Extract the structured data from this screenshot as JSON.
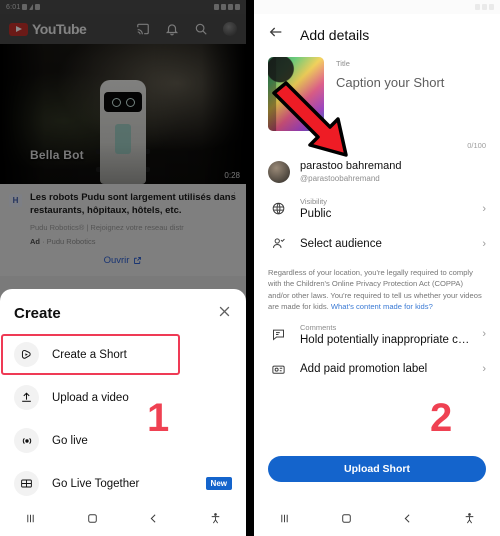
{
  "left_phone": {
    "status_bar": {
      "time": "6:01"
    },
    "youtube_header": {
      "brand": "YouTube",
      "icons": [
        "cast-icon",
        "bell-icon",
        "search-icon",
        "account-avatar"
      ]
    },
    "video": {
      "caption": "Bella Bot",
      "duration": "0:28"
    },
    "ad": {
      "badge": "H",
      "title": "Les robots Pudu sont largement utilisés dans restaurants, hôpitaux, hôtels, etc.",
      "subtitle": "Pudu Robotics® | Rejoignez votre reseau distr",
      "meta_label": "Ad",
      "meta_advertiser": "· Pudu Robotics",
      "cta": "Ouvrir",
      "menu_icon": "more-vertical-icon"
    },
    "create_sheet": {
      "title": "Create",
      "close_icon": "close-icon",
      "items": [
        {
          "label": "Create a Short",
          "icon": "shorts-icon",
          "highlighted": true,
          "badge": ""
        },
        {
          "label": "Upload a video",
          "icon": "upload-icon",
          "highlighted": false,
          "badge": ""
        },
        {
          "label": "Go live",
          "icon": "broadcast-icon",
          "highlighted": false,
          "badge": ""
        },
        {
          "label": "Go Live Together",
          "icon": "live-together-icon",
          "highlighted": false,
          "badge": "New"
        }
      ]
    },
    "nav_bar": {
      "recents": "recents-icon",
      "home": "home-icon",
      "back": "back-icon",
      "accessibility": "accessibility-icon"
    },
    "step_marker": "1"
  },
  "right_phone": {
    "header": {
      "back_icon": "back-arrow-icon",
      "title": "Add details"
    },
    "title_field": {
      "label": "Title",
      "placeholder": "Caption your Short",
      "counter": "0/100",
      "thumbnail": "short-thumbnail"
    },
    "annotation_arrow": "red-arrow-icon",
    "channel": {
      "name": "parastoo bahremand",
      "handle": "@parastoobahremand",
      "avatar": "channel-avatar"
    },
    "options": [
      {
        "label": "Visibility",
        "value": "Public",
        "icon": "globe-icon",
        "chevron": "›"
      },
      {
        "label": "",
        "value": "Select audience",
        "icon": "audience-icon",
        "chevron": "›"
      }
    ],
    "legal": {
      "text": "Regardless of your location, you're legally required to comply with the Children's Online Privacy Protection Act (COPPA) and/or other laws. You're required to tell us whether your videos are made for kids. ",
      "link": "What's content made for kids?"
    },
    "options2": [
      {
        "label": "Comments",
        "value": "Hold potentially inappropriate comme…",
        "icon": "comment-icon",
        "chevron": "›"
      },
      {
        "label": "",
        "value": "Add paid promotion label",
        "icon": "paid-promotion-icon",
        "chevron": "›"
      }
    ],
    "upload_button": "Upload Short",
    "nav_bar": {
      "recents": "recents-icon",
      "home": "home-icon",
      "back": "back-icon",
      "accessibility": "accessibility-icon"
    },
    "step_marker": "2"
  },
  "colors": {
    "youtube_red": "#c4302b",
    "accent_blue": "#1464cc",
    "step_red": "#ef4152",
    "highlight_red": "#ef3a55",
    "link_blue": "#3b7ad4"
  }
}
